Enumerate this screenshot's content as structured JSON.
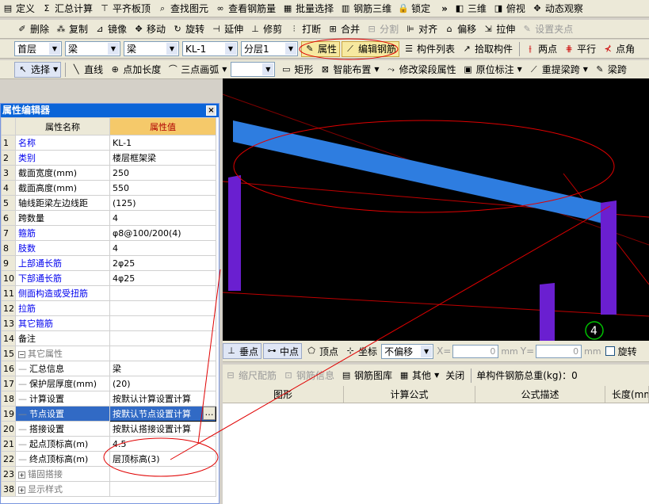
{
  "toolbar1": {
    "items": [
      {
        "icon": "define-icon",
        "glyph": "▤",
        "label": "定义"
      },
      {
        "icon": "sum-icon",
        "glyph": "Σ",
        "label": "汇总计算"
      },
      {
        "icon": "align-slab-icon",
        "glyph": "⊤",
        "label": "平齐板顶"
      },
      {
        "icon": "find-element-icon",
        "glyph": "⌕",
        "label": "查找图元"
      },
      {
        "icon": "view-rebar-icon",
        "glyph": "∞",
        "label": "查看钢筋量"
      },
      {
        "icon": "batch-select-icon",
        "glyph": "▦",
        "label": "批量选择"
      },
      {
        "icon": "rebar-3d-icon",
        "glyph": "▥",
        "label": "钢筋三维"
      },
      {
        "icon": "lock-icon",
        "glyph": "🔒",
        "label": "锁定"
      }
    ],
    "more": "»",
    "view_items": [
      {
        "icon": "cube-3d-icon",
        "glyph": "◧",
        "label": "三维"
      },
      {
        "icon": "top-view-icon",
        "glyph": "◨",
        "label": "俯视"
      },
      {
        "icon": "dynamic-observe-icon",
        "glyph": "✥",
        "label": "动态观察"
      }
    ]
  },
  "toolbar2": {
    "items": [
      {
        "icon": "delete-icon",
        "glyph": "✐",
        "label": "删除",
        "disabled": false
      },
      {
        "icon": "copy-icon",
        "glyph": "⁂",
        "label": "复制",
        "disabled": false
      },
      {
        "icon": "mirror-icon",
        "glyph": "⊿",
        "label": "镜像",
        "disabled": false
      },
      {
        "icon": "move-icon",
        "glyph": "✥",
        "label": "移动",
        "disabled": false
      },
      {
        "icon": "rotate-icon",
        "glyph": "↻",
        "label": "旋转",
        "disabled": false
      },
      {
        "icon": "extend-icon",
        "glyph": "⊣",
        "label": "延伸",
        "disabled": false
      },
      {
        "icon": "trim-icon",
        "glyph": "⊥",
        "label": "修剪",
        "disabled": false
      },
      {
        "icon": "break-icon",
        "glyph": "⫶",
        "label": "打断",
        "disabled": false
      },
      {
        "icon": "merge-icon",
        "glyph": "⊞",
        "label": "合并",
        "disabled": false
      },
      {
        "icon": "split-icon",
        "glyph": "⊟",
        "label": "分割",
        "disabled": true
      },
      {
        "icon": "align-icon",
        "glyph": "⊫",
        "label": "对齐",
        "disabled": false
      },
      {
        "icon": "offset-icon",
        "glyph": "⌂",
        "label": "偏移",
        "disabled": false
      },
      {
        "icon": "stretch-icon",
        "glyph": "⇲",
        "label": "拉伸",
        "disabled": false
      },
      {
        "icon": "set-grip-icon",
        "glyph": "✎",
        "label": "设置夹点",
        "disabled": true
      }
    ]
  },
  "toolbar3": {
    "floor": "首层",
    "type1": "梁",
    "type2": "梁",
    "element": "KL-1",
    "layer": "分层1",
    "property_label": "属性",
    "edit_rebar_label": "编辑钢筋",
    "component_list_label": "构件列表",
    "pick_component_label": "拾取构件",
    "two_points_label": "两点",
    "parallel_label": "平行",
    "point_angle_label": "点角"
  },
  "toolbar4": {
    "select_label": "选择",
    "line_label": "直线",
    "point_length_label": "点加长度",
    "arc_label": "三点画弧",
    "rect_label": "矩形",
    "smart_layout_label": "智能布置",
    "modify_span_label": "修改梁段属性",
    "origin_mark_label": "原位标注",
    "relift_span_label": "重提梁跨",
    "beam_label": "梁跨"
  },
  "panel": {
    "title": "属性编辑器",
    "close": "×",
    "col_name": "属性名称",
    "col_value": "属性值",
    "rows": [
      {
        "num": "1",
        "name": "名称",
        "value": "KL-1",
        "style": "blue"
      },
      {
        "num": "2",
        "name": "类别",
        "value": "楼层框架梁",
        "style": "blue"
      },
      {
        "num": "3",
        "name": "截面宽度(mm)",
        "value": "250",
        "style": ""
      },
      {
        "num": "4",
        "name": "截面高度(mm)",
        "value": "550",
        "style": ""
      },
      {
        "num": "5",
        "name": "轴线距梁左边线距",
        "value": "(125)",
        "style": ""
      },
      {
        "num": "6",
        "name": "跨数量",
        "value": "4",
        "style": ""
      },
      {
        "num": "7",
        "name": "箍筋",
        "value": "φ8@100/200(4)",
        "style": "blue"
      },
      {
        "num": "8",
        "name": "肢数",
        "value": "4",
        "style": "blue"
      },
      {
        "num": "9",
        "name": "上部通长筋",
        "value": "2φ25",
        "style": "blue"
      },
      {
        "num": "10",
        "name": "下部通长筋",
        "value": "4φ25",
        "style": "blue"
      },
      {
        "num": "11",
        "name": "侧面构造或受扭筋",
        "value": "",
        "style": "blue"
      },
      {
        "num": "12",
        "name": "拉筋",
        "value": "",
        "style": "blue"
      },
      {
        "num": "13",
        "name": "其它箍筋",
        "value": "",
        "style": "blue"
      },
      {
        "num": "14",
        "name": "备注",
        "value": "",
        "style": ""
      },
      {
        "num": "15",
        "name": "其它属性",
        "value": "",
        "style": "group"
      },
      {
        "num": "16",
        "name": "汇总信息",
        "value": "梁",
        "style": "child"
      },
      {
        "num": "17",
        "name": "保护层厚度(mm)",
        "value": "(20)",
        "style": "child"
      },
      {
        "num": "18",
        "name": "计算设置",
        "value": "按默认计算设置计算",
        "style": "child"
      },
      {
        "num": "19",
        "name": "节点设置",
        "value": "按默认节点设置计算",
        "style": "selected"
      },
      {
        "num": "20",
        "name": "搭接设置",
        "value": "按默认搭接设置计算",
        "style": "child"
      },
      {
        "num": "21",
        "name": "起点顶标高(m)",
        "value": "4.5",
        "style": "child"
      },
      {
        "num": "22",
        "name": "终点顶标高(m)",
        "value": "层顶标高(3)",
        "style": "child"
      },
      {
        "num": "23",
        "name": "锚固搭接",
        "value": "",
        "style": "group"
      },
      {
        "num": "38",
        "name": "显示样式",
        "value": "",
        "style": "group"
      }
    ],
    "group_sign_open": "−",
    "group_sign_closed": "+",
    "ellipsis": "…"
  },
  "viewport": {
    "axis_label": "4",
    "beam_color": "#2e7de0",
    "column_color": "#6a1fd0",
    "annotation_color": "#e00000"
  },
  "snapbar": {
    "perpendicular_label": "垂点",
    "midpoint_label": "中点",
    "vertex_label": "顶点",
    "coordinate_label": "坐标",
    "offset_option": "不偏移",
    "x_label": "X=",
    "x_value": "0",
    "mm1": "mm",
    "y_label": "Y=",
    "y_value": "0",
    "mm2": "mm",
    "rotate_label": "旋转"
  },
  "steelbar": {
    "scale_rebar_label": "缩尺配筋",
    "rebar_info_label": "钢筋信息",
    "rebar_library_label": "钢筋图库",
    "other_label": "其他",
    "close_label": "关闭",
    "total_label": "单构件钢筋总重(kg)：0"
  },
  "steelgrid": {
    "columns": [
      "",
      "图形",
      "计算公式",
      "公式描述",
      "长度(mm)"
    ]
  }
}
